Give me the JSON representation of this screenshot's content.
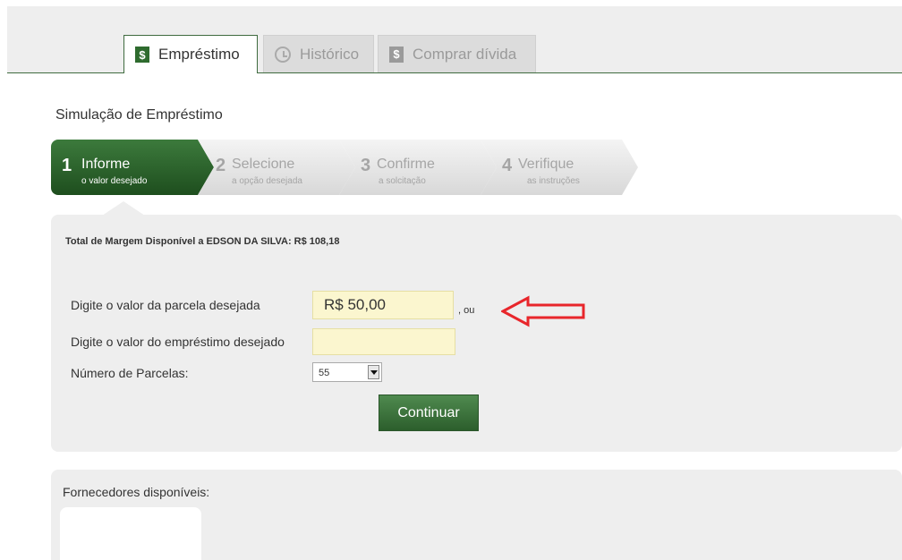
{
  "tabs": [
    {
      "label": "Empréstimo",
      "icon": "dollar-icon",
      "active": true
    },
    {
      "label": "Histórico",
      "icon": "clock-icon",
      "active": false
    },
    {
      "label": "Comprar dívida",
      "icon": "dollar-icon",
      "active": false
    }
  ],
  "page_title": "Simulação de Empréstimo",
  "steps": [
    {
      "num": "1",
      "title": "Informe",
      "sub": "o valor desejado",
      "active": true
    },
    {
      "num": "2",
      "title": "Selecione",
      "sub": "a opção desejada",
      "active": false
    },
    {
      "num": "3",
      "title": "Confirme",
      "sub": "a solcitação",
      "active": false
    },
    {
      "num": "4",
      "title": "Verifique",
      "sub": "as instruções",
      "active": false
    }
  ],
  "form": {
    "margin_info": "Total de Margem Disponível a EDSON DA SILVA: R$ 108,18",
    "installment_label": "Digite o valor da parcela desejada",
    "installment_value": "R$ 50,00",
    "or_text": ", ou",
    "loan_label": "Digite o valor do empréstimo desejado",
    "loan_value": "",
    "parcels_label": "Número de Parcelas:",
    "parcels_selected": "55",
    "continue_label": "Continuar"
  },
  "suppliers": {
    "title": "Fornecedores disponíveis:"
  },
  "colors": {
    "brand_green": "#2e6b2e",
    "input_bg": "#fbf6cf",
    "arrow_red": "#e8262b",
    "panel_bg": "#eeeeee"
  }
}
